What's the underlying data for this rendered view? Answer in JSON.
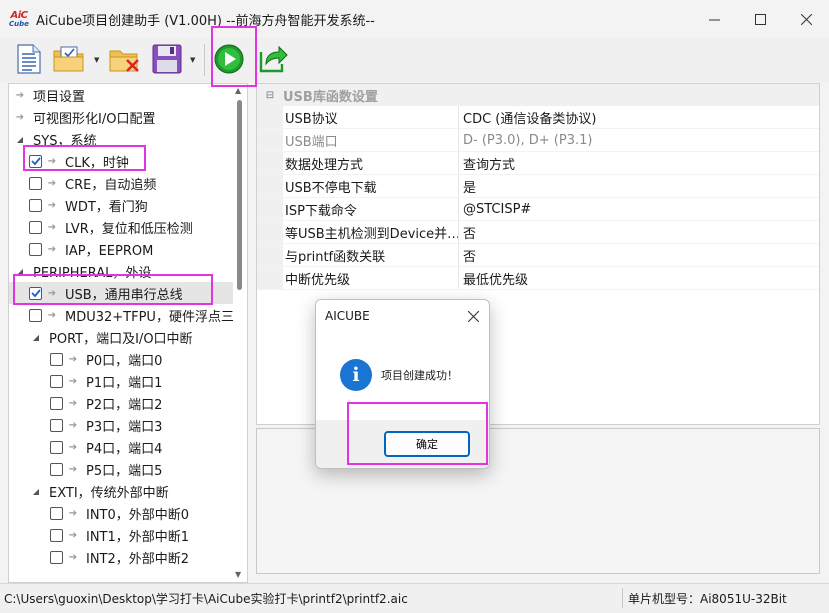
{
  "window": {
    "logo_top": "AiC",
    "logo_bottom": "Cube",
    "title": "AiCube项目创建助手 (V1.00H) --前海方舟智能开发系统--"
  },
  "tree": {
    "items": [
      {
        "label": "项目设置"
      },
      {
        "label": "可视图形化I/O口配置"
      },
      {
        "label": "SYS，系统"
      },
      {
        "label": "CLK，时钟"
      },
      {
        "label": "CRE，自动追频"
      },
      {
        "label": "WDT，看门狗"
      },
      {
        "label": "LVR，复位和低压检测"
      },
      {
        "label": "IAP，EEPROM"
      },
      {
        "label": "PERIPHERAL，外设"
      },
      {
        "label": "USB，通用串行总线"
      },
      {
        "label": "MDU32+TFPU，硬件浮点三"
      },
      {
        "label": "PORT，端口及I/O口中断"
      },
      {
        "label": "P0口，端口0"
      },
      {
        "label": "P1口，端口1"
      },
      {
        "label": "P2口，端口2"
      },
      {
        "label": "P3口，端口3"
      },
      {
        "label": "P4口，端口4"
      },
      {
        "label": "P5口，端口5"
      },
      {
        "label": "EXTI，传统外部中断"
      },
      {
        "label": "INT0，外部中断0"
      },
      {
        "label": "INT1，外部中断1"
      },
      {
        "label": "INT2，外部中断2"
      }
    ]
  },
  "props": {
    "category": "USB库函数设置",
    "rows": [
      {
        "name": "USB协议",
        "value": "CDC (通信设备类协议)"
      },
      {
        "name": "USB端口",
        "value": "D- (P3.0), D+ (P3.1)"
      },
      {
        "name": "数据处理方式",
        "value": "查询方式"
      },
      {
        "name": "USB不停电下载",
        "value": "是"
      },
      {
        "name": "ISP下载命令",
        "value": "@STCISP#"
      },
      {
        "name": "等USB主机检测到Device并…",
        "value": "否"
      },
      {
        "name": "与printf函数关联",
        "value": "否"
      },
      {
        "name": "中断优先级",
        "value": "最低优先级"
      }
    ]
  },
  "status": {
    "path": "C:\\Users\\guoxin\\Desktop\\学习打卡\\AiCube实验打卡\\printf2\\printf2.aic",
    "chip": "单片机型号：Ai8051U-32Bit"
  },
  "dialog": {
    "title": "AICUBE",
    "message": "项目创建成功！",
    "ok_label": "确定",
    "info_glyph": "i"
  },
  "colors": {
    "highlight": "#e234e2",
    "accent": "#0067c0",
    "run_green": "#1e9a2a"
  }
}
